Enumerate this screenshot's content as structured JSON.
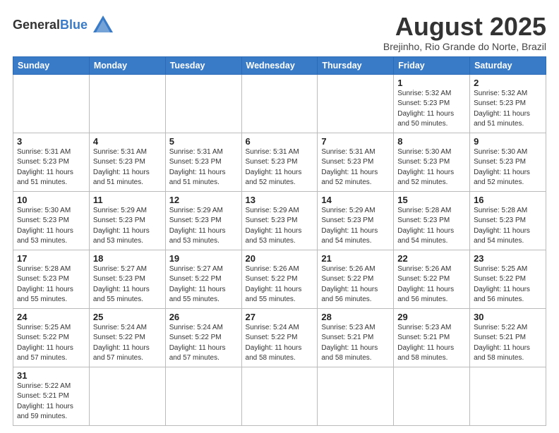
{
  "header": {
    "logo_general": "General",
    "logo_blue": "Blue",
    "month_title": "August 2025",
    "subtitle": "Brejinho, Rio Grande do Norte, Brazil"
  },
  "weekdays": [
    "Sunday",
    "Monday",
    "Tuesday",
    "Wednesday",
    "Thursday",
    "Friday",
    "Saturday"
  ],
  "weeks": [
    [
      {
        "day": "",
        "info": ""
      },
      {
        "day": "",
        "info": ""
      },
      {
        "day": "",
        "info": ""
      },
      {
        "day": "",
        "info": ""
      },
      {
        "day": "",
        "info": ""
      },
      {
        "day": "1",
        "info": "Sunrise: 5:32 AM\nSunset: 5:23 PM\nDaylight: 11 hours\nand 50 minutes."
      },
      {
        "day": "2",
        "info": "Sunrise: 5:32 AM\nSunset: 5:23 PM\nDaylight: 11 hours\nand 51 minutes."
      }
    ],
    [
      {
        "day": "3",
        "info": "Sunrise: 5:31 AM\nSunset: 5:23 PM\nDaylight: 11 hours\nand 51 minutes."
      },
      {
        "day": "4",
        "info": "Sunrise: 5:31 AM\nSunset: 5:23 PM\nDaylight: 11 hours\nand 51 minutes."
      },
      {
        "day": "5",
        "info": "Sunrise: 5:31 AM\nSunset: 5:23 PM\nDaylight: 11 hours\nand 51 minutes."
      },
      {
        "day": "6",
        "info": "Sunrise: 5:31 AM\nSunset: 5:23 PM\nDaylight: 11 hours\nand 52 minutes."
      },
      {
        "day": "7",
        "info": "Sunrise: 5:31 AM\nSunset: 5:23 PM\nDaylight: 11 hours\nand 52 minutes."
      },
      {
        "day": "8",
        "info": "Sunrise: 5:30 AM\nSunset: 5:23 PM\nDaylight: 11 hours\nand 52 minutes."
      },
      {
        "day": "9",
        "info": "Sunrise: 5:30 AM\nSunset: 5:23 PM\nDaylight: 11 hours\nand 52 minutes."
      }
    ],
    [
      {
        "day": "10",
        "info": "Sunrise: 5:30 AM\nSunset: 5:23 PM\nDaylight: 11 hours\nand 53 minutes."
      },
      {
        "day": "11",
        "info": "Sunrise: 5:29 AM\nSunset: 5:23 PM\nDaylight: 11 hours\nand 53 minutes."
      },
      {
        "day": "12",
        "info": "Sunrise: 5:29 AM\nSunset: 5:23 PM\nDaylight: 11 hours\nand 53 minutes."
      },
      {
        "day": "13",
        "info": "Sunrise: 5:29 AM\nSunset: 5:23 PM\nDaylight: 11 hours\nand 53 minutes."
      },
      {
        "day": "14",
        "info": "Sunrise: 5:29 AM\nSunset: 5:23 PM\nDaylight: 11 hours\nand 54 minutes."
      },
      {
        "day": "15",
        "info": "Sunrise: 5:28 AM\nSunset: 5:23 PM\nDaylight: 11 hours\nand 54 minutes."
      },
      {
        "day": "16",
        "info": "Sunrise: 5:28 AM\nSunset: 5:23 PM\nDaylight: 11 hours\nand 54 minutes."
      }
    ],
    [
      {
        "day": "17",
        "info": "Sunrise: 5:28 AM\nSunset: 5:23 PM\nDaylight: 11 hours\nand 55 minutes."
      },
      {
        "day": "18",
        "info": "Sunrise: 5:27 AM\nSunset: 5:23 PM\nDaylight: 11 hours\nand 55 minutes."
      },
      {
        "day": "19",
        "info": "Sunrise: 5:27 AM\nSunset: 5:22 PM\nDaylight: 11 hours\nand 55 minutes."
      },
      {
        "day": "20",
        "info": "Sunrise: 5:26 AM\nSunset: 5:22 PM\nDaylight: 11 hours\nand 55 minutes."
      },
      {
        "day": "21",
        "info": "Sunrise: 5:26 AM\nSunset: 5:22 PM\nDaylight: 11 hours\nand 56 minutes."
      },
      {
        "day": "22",
        "info": "Sunrise: 5:26 AM\nSunset: 5:22 PM\nDaylight: 11 hours\nand 56 minutes."
      },
      {
        "day": "23",
        "info": "Sunrise: 5:25 AM\nSunset: 5:22 PM\nDaylight: 11 hours\nand 56 minutes."
      }
    ],
    [
      {
        "day": "24",
        "info": "Sunrise: 5:25 AM\nSunset: 5:22 PM\nDaylight: 11 hours\nand 57 minutes."
      },
      {
        "day": "25",
        "info": "Sunrise: 5:24 AM\nSunset: 5:22 PM\nDaylight: 11 hours\nand 57 minutes."
      },
      {
        "day": "26",
        "info": "Sunrise: 5:24 AM\nSunset: 5:22 PM\nDaylight: 11 hours\nand 57 minutes."
      },
      {
        "day": "27",
        "info": "Sunrise: 5:24 AM\nSunset: 5:22 PM\nDaylight: 11 hours\nand 58 minutes."
      },
      {
        "day": "28",
        "info": "Sunrise: 5:23 AM\nSunset: 5:21 PM\nDaylight: 11 hours\nand 58 minutes."
      },
      {
        "day": "29",
        "info": "Sunrise: 5:23 AM\nSunset: 5:21 PM\nDaylight: 11 hours\nand 58 minutes."
      },
      {
        "day": "30",
        "info": "Sunrise: 5:22 AM\nSunset: 5:21 PM\nDaylight: 11 hours\nand 58 minutes."
      }
    ],
    [
      {
        "day": "31",
        "info": "Sunrise: 5:22 AM\nSunset: 5:21 PM\nDaylight: 11 hours\nand 59 minutes."
      },
      {
        "day": "",
        "info": ""
      },
      {
        "day": "",
        "info": ""
      },
      {
        "day": "",
        "info": ""
      },
      {
        "day": "",
        "info": ""
      },
      {
        "day": "",
        "info": ""
      },
      {
        "day": "",
        "info": ""
      }
    ]
  ]
}
